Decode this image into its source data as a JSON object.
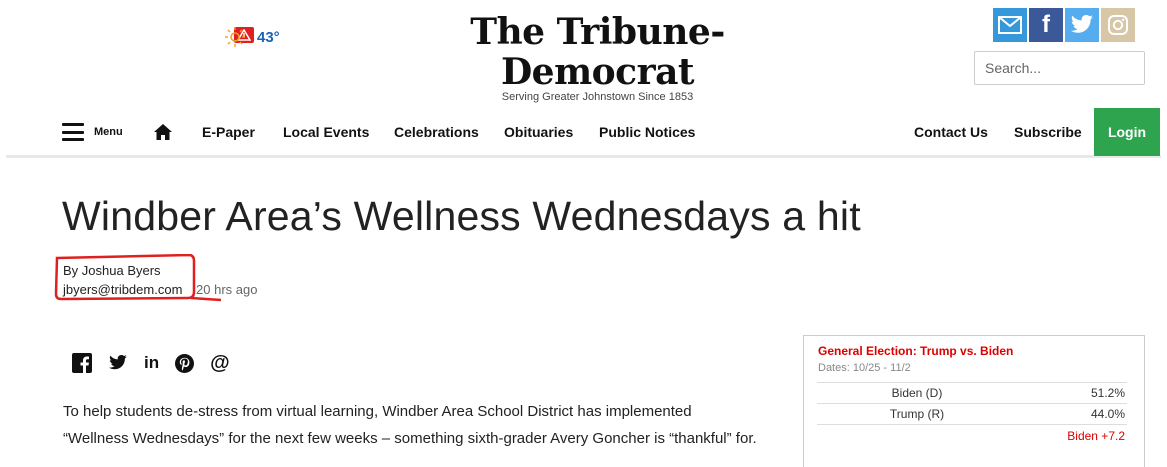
{
  "weather": {
    "temp": "43°",
    "alert_icon": "alert-triangle-icon",
    "sun_icon": "sun-icon"
  },
  "masthead": {
    "title": "The Tribune-Democrat",
    "tagline": "Serving Greater Johnstown Since 1853"
  },
  "social": [
    {
      "name": "email-icon",
      "color": "#3498db"
    },
    {
      "name": "facebook-icon",
      "color": "#3b5998"
    },
    {
      "name": "twitter-icon",
      "color": "#55acee"
    },
    {
      "name": "instagram-icon",
      "color": "#d8c7a6"
    }
  ],
  "search": {
    "placeholder": "Search..."
  },
  "nav": {
    "menu_label": "Menu",
    "home_icon": "home-icon",
    "items": [
      "E-Paper",
      "Local Events",
      "Celebrations",
      "Obituaries",
      "Public Notices"
    ],
    "right_items": [
      "Contact Us",
      "Subscribe"
    ],
    "login_label": "Login",
    "login_color": "#2ea44f"
  },
  "article": {
    "headline": "Windber Area’s Wellness Wednesdays a hit",
    "byline": "By Joshua Byers",
    "email": "jbyers@tribdem.com",
    "time_ago": "20 hrs ago",
    "body_line1": "To help students de-stress from virtual learning, Windber Area School District has implemented",
    "body_line2": "“Wellness Wednesdays” for the next few weeks – something sixth-grader Avery Goncher is “thankful” for.",
    "annotation_color": "#e02020"
  },
  "share_icons": [
    "facebook-icon",
    "twitter-icon",
    "linkedin-icon",
    "pinterest-icon",
    "email-at-icon"
  ],
  "poll": {
    "title": "General Election: Trump vs. Biden",
    "dates": "Dates: 10/25 - 11/2",
    "rows": [
      {
        "candidate": "Biden (D)",
        "pct": "51.2%"
      },
      {
        "candidate": "Trump (R)",
        "pct": "44.0%"
      }
    ],
    "margin": "Biden +7.2"
  }
}
